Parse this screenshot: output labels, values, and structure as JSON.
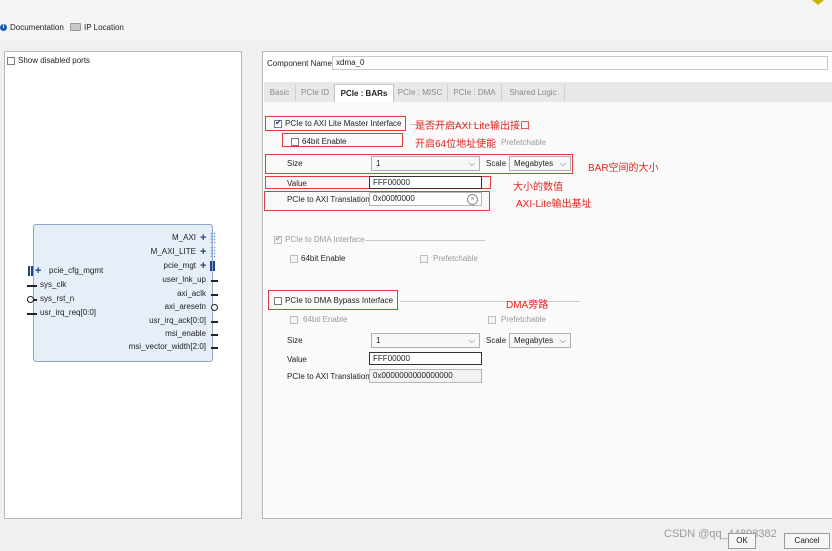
{
  "toolbar": {
    "documentation": "Documentation",
    "ip_location": "IP Location"
  },
  "left_panel": {
    "show_disabled_ports": "Show disabled ports",
    "ports_left": [
      "pcie_cfg_mgmt",
      "sys_clk",
      "sys_rst_n",
      "usr_irq_req[0:0]"
    ],
    "ports_right": [
      "M_AXI",
      "M_AXI_LITE",
      "pcie_mgt",
      "user_lnk_up",
      "axi_aclk",
      "axi_aresetn",
      "usr_irq_ack[0:0]",
      "msi_enable",
      "msi_vector_width[2:0]"
    ]
  },
  "component": {
    "label": "Component Name",
    "value": "xdma_0"
  },
  "tabs": [
    "Basic",
    "PCIe ID",
    "PCIe : BARs",
    "PCIe : MISC",
    "PCIe : DMA",
    "Shared Logic"
  ],
  "axi_lite": {
    "enable_label": "PCIe to AXI Lite Master Interface",
    "bit64_label": "64bit Enable",
    "prefetch_label": "Prefetchable",
    "size_label": "Size",
    "size_value": "1",
    "scale_label": "Scale",
    "scale_value": "Megabytes",
    "value_label": "Value",
    "value": "FFF00000",
    "translation_label": "PCIe to AXI Translation",
    "translation_value": "0x000f0000"
  },
  "dma_interface": {
    "label": "PCIe to DMA Interface",
    "bit64_label": "64bit Enable",
    "prefetch_label": "Prefetchable"
  },
  "dma_bypass": {
    "label": "PCIe to DMA Bypass Interface",
    "bit64_label": "64bit Enable",
    "prefetch_label": "Prefetchable",
    "size_label": "Size",
    "size_value": "1",
    "scale_label": "Scale",
    "scale_value": "Megabytes",
    "value_label": "Value",
    "value": "FFF00000",
    "translation_label": "PCIe to AXI Translation",
    "translation_value": "0x0000000000000000"
  },
  "annotations": {
    "axi_lite": "是否开启AXI Lite输出接口",
    "bit64": "开启64位地址使能",
    "bar_size": "BAR空间的大小",
    "value": "大小的数值",
    "base": "AXI-Lite输出基址",
    "bypass": "DMA旁路"
  },
  "buttons": {
    "ok": "OK",
    "cancel": "Cancel"
  },
  "watermark": "CSDN @qq_44898382",
  "colors": {
    "annotation": "#e4231f",
    "accent": "#1f3f8f"
  }
}
